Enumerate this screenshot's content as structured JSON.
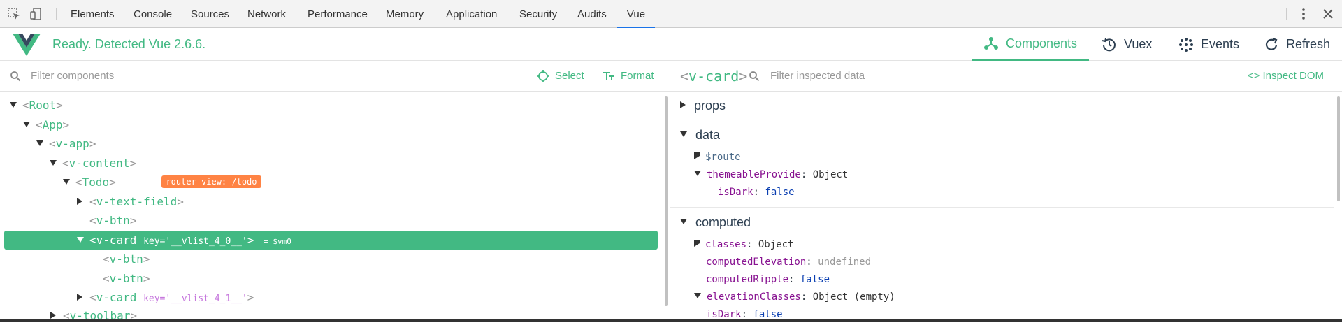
{
  "devtools": {
    "tabs": [
      "Elements",
      "Console",
      "Sources",
      "Network",
      "Performance",
      "Memory",
      "Application",
      "Security",
      "Audits",
      "Vue"
    ],
    "active_tab": "Vue",
    "icons": [
      "inspect-element-icon",
      "device-toolbar-icon",
      "more-options-icon",
      "close-icon"
    ]
  },
  "header": {
    "status": "Ready. Detected Vue 2.6.6.",
    "nav": [
      "Components",
      "Vuex",
      "Events",
      "Refresh"
    ]
  },
  "left": {
    "search_placeholder": "Filter components",
    "select_label": "Select",
    "format_label": "Format",
    "tree": [
      {
        "name": "Root"
      },
      {
        "name": "App"
      },
      {
        "name": "v-app"
      },
      {
        "name": "v-content"
      },
      {
        "name": "Todo",
        "badge": "router-view: /todo"
      },
      {
        "name": "v-text-field"
      },
      {
        "name": "v-btn"
      },
      {
        "name": "v-card",
        "key": "key='__vlist_4_0__'",
        "vm": "= $vm0"
      },
      {
        "name": "v-btn"
      },
      {
        "name": "v-btn"
      },
      {
        "name": "v-card",
        "key": "key='__vlist_4_1__'"
      },
      {
        "name": "v-toolbar"
      }
    ]
  },
  "right": {
    "component": "v-card",
    "search_placeholder": "Filter inspected data",
    "inspect_label": "Inspect DOM",
    "sections": {
      "props": "props",
      "data": "data",
      "computed": "computed"
    },
    "data_items": [
      {
        "key": "$route"
      },
      {
        "key": "themeableProvide",
        "value": "Object"
      },
      {
        "key": "isDark",
        "value": "false"
      }
    ],
    "computed_items": [
      {
        "key": "classes",
        "value": "Object"
      },
      {
        "key": "computedElevation",
        "value": "undefined"
      },
      {
        "key": "computedRipple",
        "value": "false"
      },
      {
        "key": "elevationClasses",
        "value": "Object (empty)"
      },
      {
        "key": "isDark",
        "value": "false"
      }
    ]
  },
  "colors": {
    "accent": "#42b983",
    "badge": "#ff8344",
    "devtools_active": "#1a73e8"
  }
}
